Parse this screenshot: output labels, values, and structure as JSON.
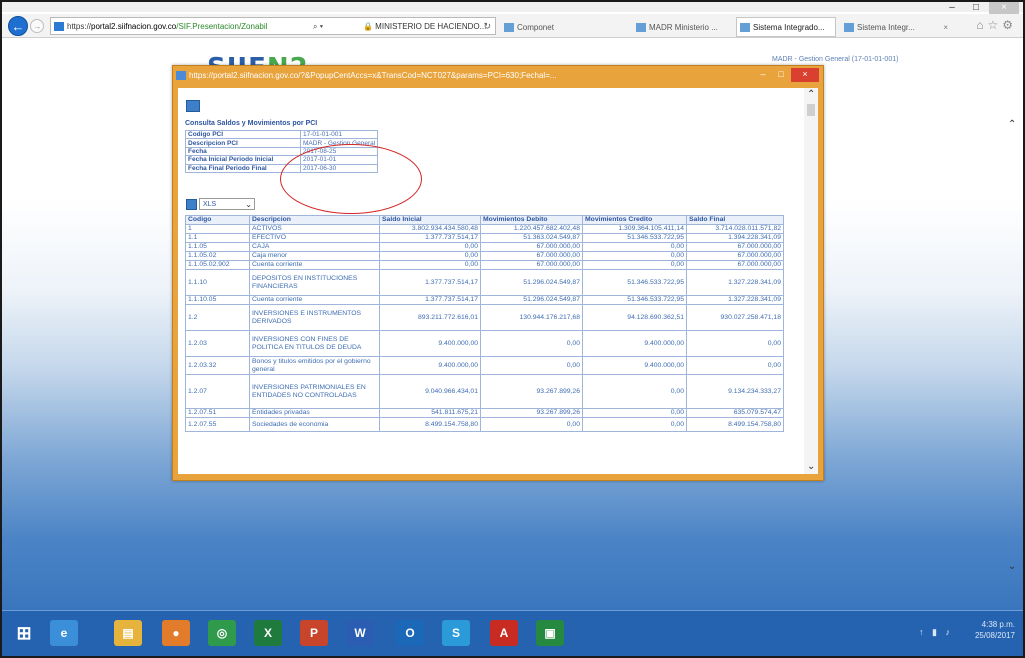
{
  "browser": {
    "address_url_prefix": "https://",
    "address_url_host": "portal2.siifnacion.gov.co",
    "address_url_path": "/SIF.Presentacion/Zonabil",
    "address_search_glyph": "⌕ ▾",
    "address_lock_tab": "🔒 MINISTERIO DE HACIENDO...",
    "address_refresh": "↻",
    "tabs": [
      {
        "label": "Componet",
        "active": false
      },
      {
        "label": "MADR Ministerio ...",
        "active": false
      },
      {
        "label": "Sistema Integrado...",
        "active": true
      },
      {
        "label": "Sistema Integr...",
        "active": false
      }
    ],
    "tab_close_glyph": "×",
    "window_controls": {
      "minimize": "–",
      "maximize": "□",
      "close": "×"
    },
    "toolbar_glyphs": "⌂☆⚙"
  },
  "page": {
    "logo_main": "SIIF",
    "logo_tail": "N2",
    "header_text": "MADR - Gestion General (17-01-01-001)"
  },
  "popup": {
    "title": "https://portal2.siifnacion.gov.co/?&PopupCentAccs=x&TransCod=NCT027&params=PCI=630;Fechal=...",
    "controls": {
      "minimize": "–",
      "maximize": "□",
      "close": "×"
    },
    "section_title": "Consulta Saldos y Movimientos por PCI",
    "info": [
      {
        "label": "Codigo PCI",
        "value": "17-01-01-001"
      },
      {
        "label": "Descripcion PCI",
        "value": "MADR - Gestion General"
      },
      {
        "label": "Fecha",
        "value": "2017-08-25"
      },
      {
        "label": "Fecha Inicial Periodo Inicial",
        "value": "2017-01-01"
      },
      {
        "label": "Fecha Final Periodo Final",
        "value": "2017-06-30"
      }
    ],
    "export_select": {
      "value": "XLS"
    },
    "table": {
      "headers": [
        "Codigo",
        "Descripcion",
        "Saldo Inicial",
        "Movimientos Debito",
        "Movimientos Credito",
        "Saldo Final"
      ],
      "rows": [
        [
          "1",
          "ACTIVOS",
          "3.802.934.434.580,48",
          "1.220.457.682.402,48",
          "1.309.364.105.411,14",
          "3.714.028.011.571,82"
        ],
        [
          "1.1",
          "EFECTIVO",
          "1.377.737.514,17",
          "51.363.024.549,87",
          "51.346.533.722,95",
          "1.394.228.341,09"
        ],
        [
          "1.1.05",
          "CAJA",
          "0,00",
          "67.000.000,00",
          "0,00",
          "67.000.000,00"
        ],
        [
          "1.1.05.02",
          "Caja menor",
          "0,00",
          "67.000.000,00",
          "0,00",
          "67.000.000,00"
        ],
        [
          "1.1.05.02.902",
          "Cuenta corriente",
          "0,00",
          "67.000.000,00",
          "0,00",
          "67.000.000,00"
        ],
        [
          "1.1.10",
          "DEPOSITOS EN INSTITUCIONES FINANCIERAS",
          "1.377.737.514,17",
          "51.296.024.549,87",
          "51.346.533.722,95",
          "1.327.228.341,09"
        ],
        [
          "1.1.10.05",
          "Cuenta corriente",
          "1.377.737.514,17",
          "51.296.024.549,87",
          "51.346.533.722,95",
          "1.327.228.341,09"
        ],
        [
          "1.2",
          "INVERSIONES E INSTRUMENTOS DERIVADOS",
          "893.211.772.616,01",
          "130.944.176.217,68",
          "94.128.690.362,51",
          "930.027.258.471,18"
        ],
        [
          "1.2.03",
          "INVERSIONES CON FINES DE POLITICA EN TITULOS DE DEUDA",
          "9.400.000,00",
          "0,00",
          "9.400.000,00",
          "0,00"
        ],
        [
          "1.2.03.32",
          "Bonos y titulos emitidos por el gobierno general",
          "9.400.000,00",
          "0,00",
          "9.400.000,00",
          "0,00"
        ],
        [
          "1.2.07",
          "INVERSIONES PATRIMONIALES EN ENTIDADES NO CONTROLADAS",
          "9.040.966.434,01",
          "93.267.899,26",
          "0,00",
          "9.134.234.333,27"
        ],
        [
          "1.2.07.51",
          "Entidades privadas",
          "541.811.675,21",
          "93.267.899,26",
          "0,00",
          "635.079.574,47"
        ],
        [
          "1.2.07.55",
          "Sociedades de economia",
          "8.499.154.758,80",
          "0,00",
          "0,00",
          "8.499.154.758,80"
        ]
      ]
    }
  },
  "taskbar": {
    "apps": [
      {
        "name": "windows-start",
        "glyph": "⊞"
      },
      {
        "name": "internet-explorer",
        "glyph": "e"
      },
      {
        "name": "file-explorer",
        "glyph": "▤"
      },
      {
        "name": "firefox",
        "glyph": "●"
      },
      {
        "name": "chrome",
        "glyph": "◎"
      },
      {
        "name": "excel",
        "glyph": "X"
      },
      {
        "name": "powerpoint",
        "glyph": "P"
      },
      {
        "name": "word",
        "glyph": "W"
      },
      {
        "name": "outlook",
        "glyph": "O"
      },
      {
        "name": "skype",
        "glyph": "S"
      },
      {
        "name": "acrobat",
        "glyph": "A"
      },
      {
        "name": "project",
        "glyph": "▣"
      }
    ],
    "tray_glyphs": "↑ ▮ ♪",
    "clock_time": "4:38 p.m.",
    "clock_date": "25/08/2017"
  }
}
